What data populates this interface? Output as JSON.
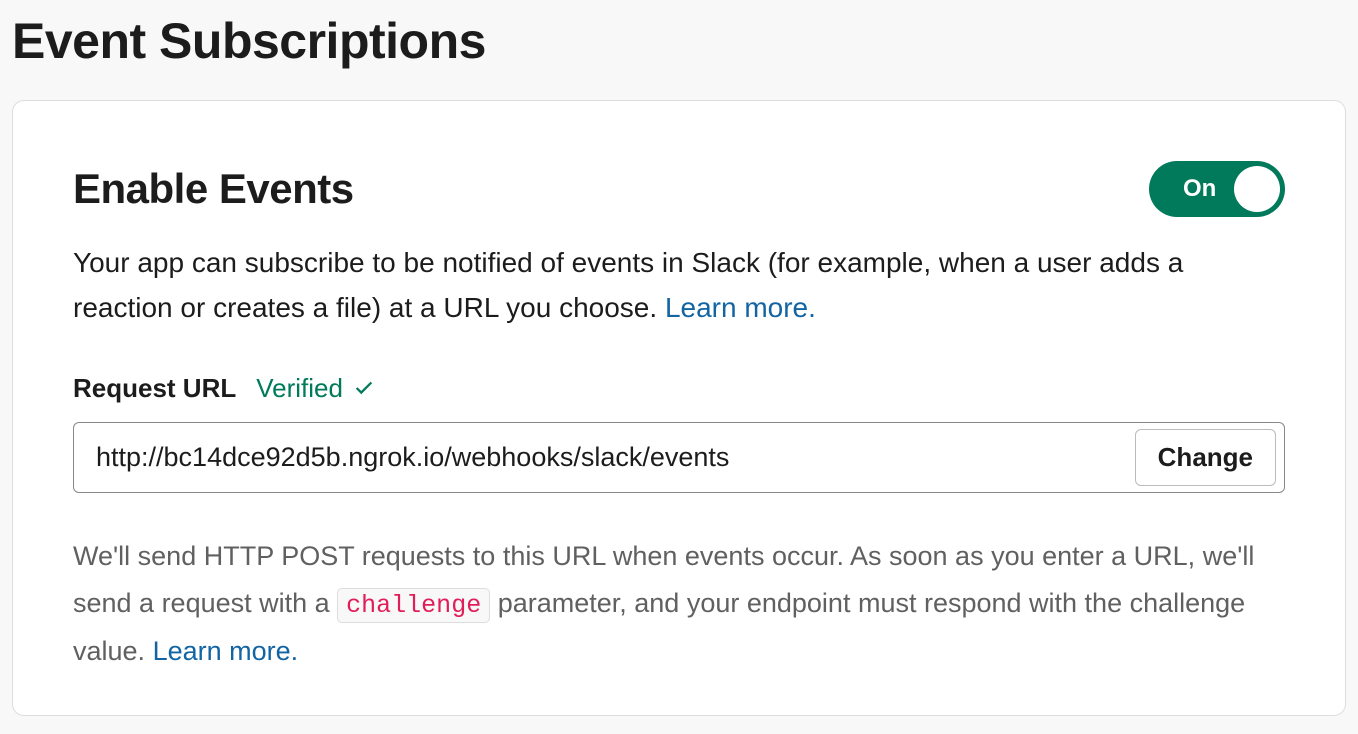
{
  "page": {
    "title": "Event Subscriptions"
  },
  "card": {
    "title": "Enable Events",
    "toggle": {
      "state_label": "On",
      "enabled": true
    },
    "description_part1": "Your app can subscribe to be notified of events in Slack (for example, when a user adds a reaction or creates a file) at a URL you choose. ",
    "description_link": "Learn more.",
    "request_url": {
      "label": "Request URL",
      "status": "Verified",
      "value": "http://bc14dce92d5b.ngrok.io/webhooks/slack/events",
      "change_button": "Change"
    },
    "help": {
      "part1": "We'll send HTTP POST requests to this URL when events occur. As soon as you enter a URL, we'll send a request with a ",
      "code": "challenge",
      "part2": " parameter, and your endpoint must respond with the challenge value. ",
      "link": "Learn more."
    }
  }
}
